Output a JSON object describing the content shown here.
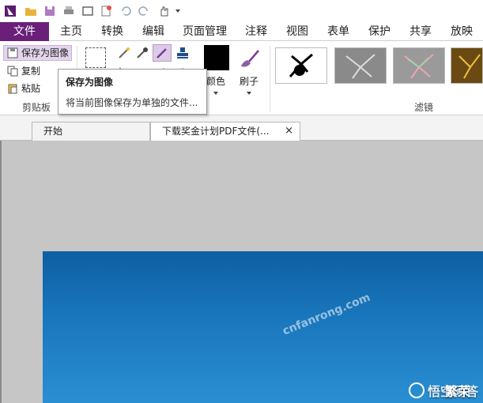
{
  "colors": {
    "file_tab": "#6a1f79",
    "ribbon_bg": "#ffffff",
    "canvas_bg": "#c6c6c6",
    "photo_sky": "#1a77bd"
  },
  "qat": {
    "icons": [
      "app-logo-icon",
      "open-folder-icon",
      "save-icon",
      "print-icon",
      "scan-icon",
      "new-icon",
      "undo-icon",
      "redo-icon",
      "hand-tool-icon",
      "customize-dropdown-icon"
    ]
  },
  "menu": {
    "tabs": [
      "文件",
      "主页",
      "转换",
      "编辑",
      "页面管理",
      "注释",
      "视图",
      "表单",
      "保护",
      "共享",
      "放映"
    ]
  },
  "ribbon": {
    "clipboard": {
      "save_as_image": "保存为图像",
      "copy": "复制",
      "paste": "粘贴",
      "group_label": "剪贴板"
    },
    "color_label": "颜色",
    "brush_label": "刷子",
    "filter_group_label": "滤镜"
  },
  "tooltip": {
    "title": "保存为图像",
    "description": "将当前图像保存为单独的文件..."
  },
  "doc_tabs": {
    "start": "开始",
    "active": "下载奖金计划PDF文件(...",
    "close": "×"
  },
  "canvas": {
    "watermark": "cnfanrong.com",
    "brand_text": "悟空问答",
    "brand_overlay": "繁荣网"
  }
}
